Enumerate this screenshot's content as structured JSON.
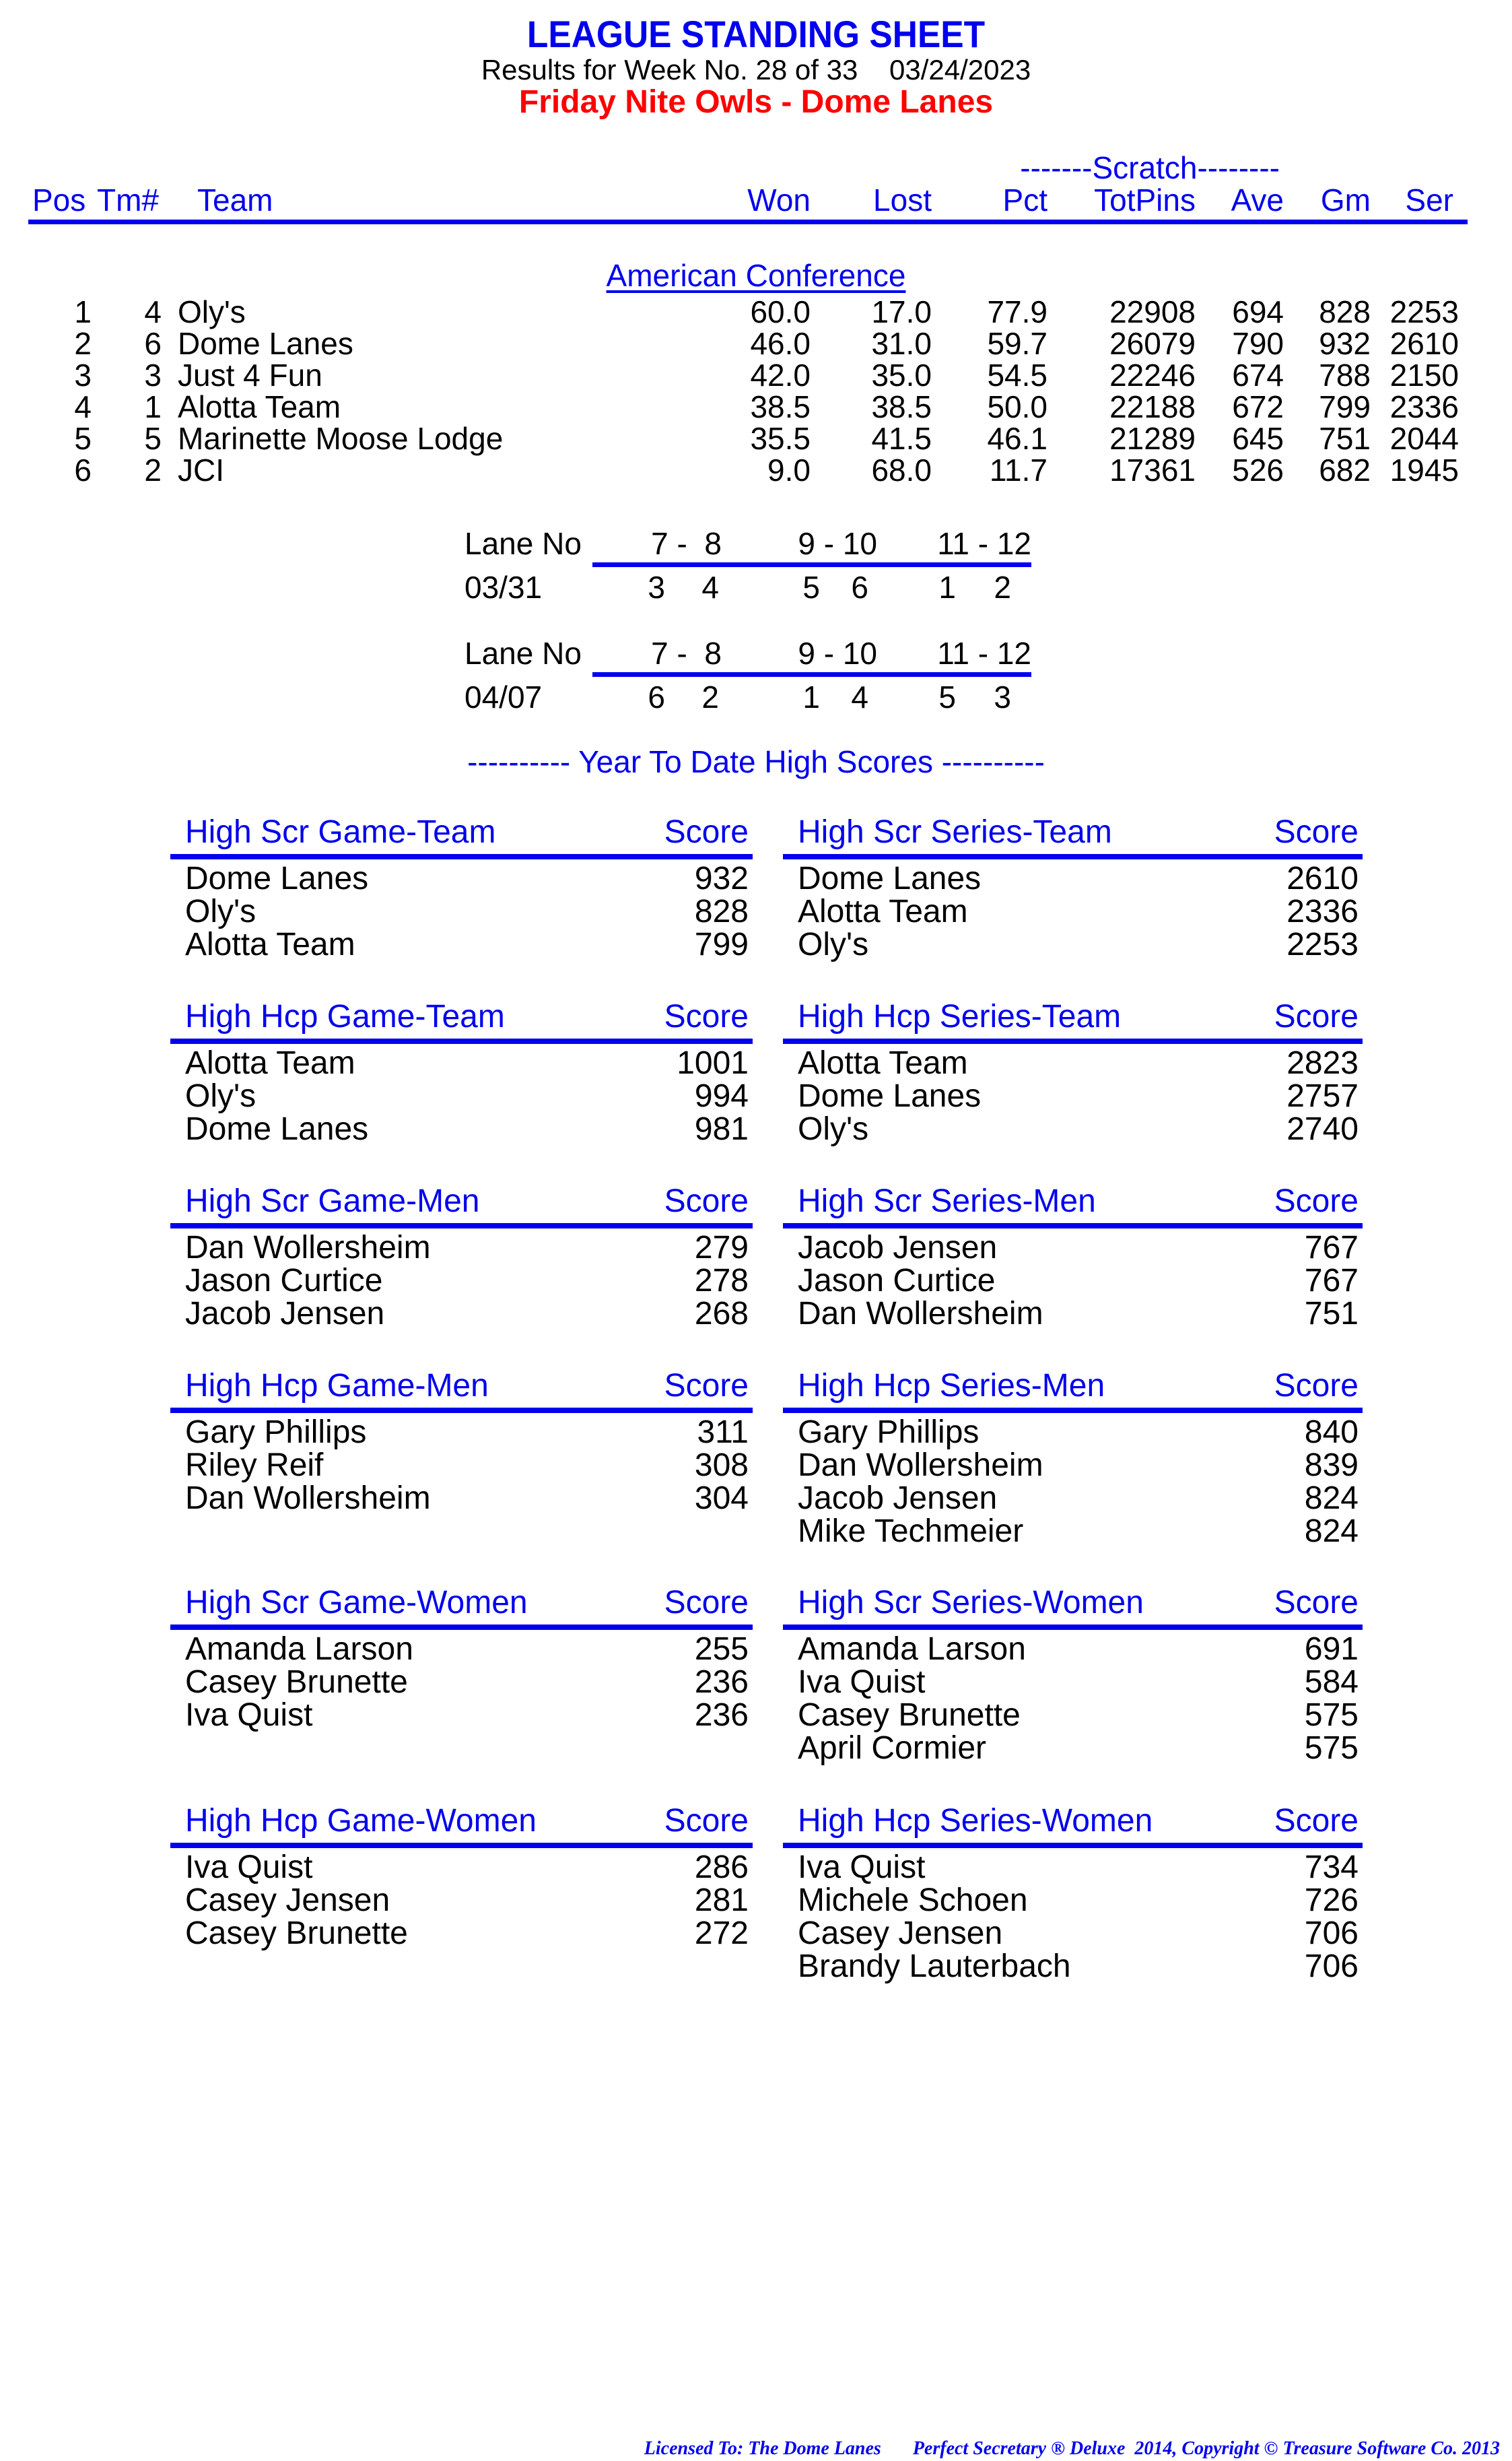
{
  "header": {
    "title": "LEAGUE STANDING SHEET",
    "subtitle": "Results for Week No. 28 of 33    03/24/2023",
    "league_name": "Friday Nite Owls - Dome Lanes"
  },
  "standings": {
    "scratch_group_label": "-------Scratch--------",
    "columns": {
      "pos": "Pos",
      "tm": "Tm#",
      "team": "Team",
      "won": "Won",
      "lost": "Lost",
      "pct": "Pct",
      "totpins": "TotPins",
      "ave": "Ave",
      "gm": "Gm",
      "ser": "Ser"
    },
    "conference": "American Conference",
    "rows": [
      {
        "pos": "1",
        "tm": "4",
        "team": "Oly's",
        "won": "60.0",
        "lost": "17.0",
        "pct": "77.9",
        "totpins": "22908",
        "ave": "694",
        "gm": "828",
        "ser": "2253"
      },
      {
        "pos": "2",
        "tm": "6",
        "team": "Dome Lanes",
        "won": "46.0",
        "lost": "31.0",
        "pct": "59.7",
        "totpins": "26079",
        "ave": "790",
        "gm": "932",
        "ser": "2610"
      },
      {
        "pos": "3",
        "tm": "3",
        "team": "Just 4 Fun",
        "won": "42.0",
        "lost": "35.0",
        "pct": "54.5",
        "totpins": "22246",
        "ave": "674",
        "gm": "788",
        "ser": "2150"
      },
      {
        "pos": "4",
        "tm": "1",
        "team": "Alotta Team",
        "won": "38.5",
        "lost": "38.5",
        "pct": "50.0",
        "totpins": "22188",
        "ave": "672",
        "gm": "799",
        "ser": "2336"
      },
      {
        "pos": "5",
        "tm": "5",
        "team": "Marinette Moose Lodge",
        "won": "35.5",
        "lost": "41.5",
        "pct": "46.1",
        "totpins": "21289",
        "ave": "645",
        "gm": "751",
        "ser": "2044"
      },
      {
        "pos": "6",
        "tm": "2",
        "team": "JCI",
        "won": "9.0",
        "lost": "68.0",
        "pct": "11.7",
        "totpins": "17361",
        "ave": "526",
        "gm": "682",
        "ser": "1945"
      }
    ]
  },
  "lane_assignments": [
    {
      "label": "Lane No",
      "lanes": [
        "7 -  8",
        "9 - 10",
        "11 - 12"
      ],
      "date": "03/31",
      "teams": [
        "3",
        "4",
        "5",
        "6",
        "1",
        "2"
      ]
    },
    {
      "label": "Lane No",
      "lanes": [
        "7 -  8",
        "9 - 10",
        "11 - 12"
      ],
      "date": "04/07",
      "teams": [
        "6",
        "2",
        "1",
        "4",
        "5",
        "3"
      ]
    }
  ],
  "ytd_title": "---------- Year To Date High Scores ----------",
  "high_scores": [
    {
      "title": "High Scr Game-Team",
      "score_label": "Score",
      "entries": [
        [
          "Dome Lanes",
          "932"
        ],
        [
          "Oly's",
          "828"
        ],
        [
          "Alotta Team",
          "799"
        ]
      ]
    },
    {
      "title": "High Scr Series-Team",
      "score_label": "Score",
      "entries": [
        [
          "Dome Lanes",
          "2610"
        ],
        [
          "Alotta Team",
          "2336"
        ],
        [
          "Oly's",
          "2253"
        ]
      ]
    },
    {
      "title": "High Hcp Game-Team",
      "score_label": "Score",
      "entries": [
        [
          "Alotta Team",
          "1001"
        ],
        [
          "Oly's",
          "994"
        ],
        [
          "Dome Lanes",
          "981"
        ]
      ]
    },
    {
      "title": "High Hcp Series-Team",
      "score_label": "Score",
      "entries": [
        [
          "Alotta Team",
          "2823"
        ],
        [
          "Dome Lanes",
          "2757"
        ],
        [
          "Oly's",
          "2740"
        ]
      ]
    },
    {
      "title": "High Scr Game-Men",
      "score_label": "Score",
      "entries": [
        [
          "Dan Wollersheim",
          "279"
        ],
        [
          "Jason Curtice",
          "278"
        ],
        [
          "Jacob Jensen",
          "268"
        ]
      ]
    },
    {
      "title": "High Scr Series-Men",
      "score_label": "Score",
      "entries": [
        [
          "Jacob Jensen",
          "767"
        ],
        [
          "Jason Curtice",
          "767"
        ],
        [
          "Dan Wollersheim",
          "751"
        ]
      ]
    },
    {
      "title": "High Hcp Game-Men",
      "score_label": "Score",
      "entries": [
        [
          "Gary Phillips",
          "311"
        ],
        [
          "Riley Reif",
          "308"
        ],
        [
          "Dan Wollersheim",
          "304"
        ]
      ]
    },
    {
      "title": "High Hcp Series-Men",
      "score_label": "Score",
      "entries": [
        [
          "Gary Phillips",
          "840"
        ],
        [
          "Dan Wollersheim",
          "839"
        ],
        [
          "Jacob Jensen",
          "824"
        ],
        [
          "Mike Techmeier",
          "824"
        ]
      ]
    },
    {
      "title": "High Scr Game-Women",
      "score_label": "Score",
      "entries": [
        [
          "Amanda Larson",
          "255"
        ],
        [
          "Casey Brunette",
          "236"
        ],
        [
          "Iva Quist",
          "236"
        ]
      ]
    },
    {
      "title": "High Scr Series-Women",
      "score_label": "Score",
      "entries": [
        [
          "Amanda Larson",
          "691"
        ],
        [
          "Iva Quist",
          "584"
        ],
        [
          "Casey Brunette",
          "575"
        ],
        [
          "April Cormier",
          "575"
        ]
      ]
    },
    {
      "title": "High Hcp Game-Women",
      "score_label": "Score",
      "entries": [
        [
          "Iva Quist",
          "286"
        ],
        [
          "Casey Jensen",
          "281"
        ],
        [
          "Casey Brunette",
          "272"
        ]
      ]
    },
    {
      "title": "High Hcp Series-Women",
      "score_label": "Score",
      "entries": [
        [
          "Iva Quist",
          "734"
        ],
        [
          "Michele Schoen",
          "726"
        ],
        [
          "Casey Jensen",
          "706"
        ],
        [
          "Brandy Lauterbach",
          "706"
        ]
      ]
    }
  ],
  "footer": {
    "license": "Licensed To: The Dome Lanes",
    "copyright": "Perfect Secretary ® Deluxe  2014, Copyright © Treasure Software Co. 2013"
  },
  "colors": {
    "heading_blue": "#0000ee",
    "league_red": "#ff0000",
    "text": "#000000"
  }
}
